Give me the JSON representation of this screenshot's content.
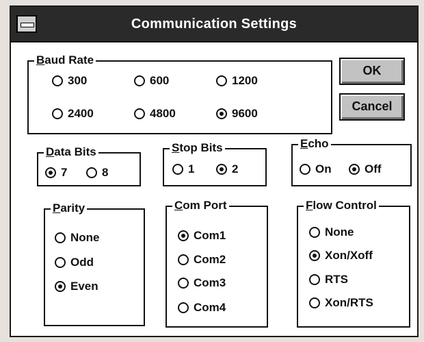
{
  "title": "Communication Settings",
  "baud_rate": {
    "legend_key": "B",
    "legend_rest": "aud Rate",
    "options": [
      {
        "label": "300",
        "selected": false
      },
      {
        "label": "600",
        "selected": false
      },
      {
        "label": "1200",
        "selected": false
      },
      {
        "label": "2400",
        "selected": false
      },
      {
        "label": "4800",
        "selected": false
      },
      {
        "label": "9600",
        "selected": true
      }
    ]
  },
  "data_bits": {
    "legend_key": "D",
    "legend_rest": "ata Bits",
    "options": [
      {
        "label": "7",
        "selected": true
      },
      {
        "label": "8",
        "selected": false
      }
    ]
  },
  "stop_bits": {
    "legend_key": "S",
    "legend_rest": "top Bits",
    "options": [
      {
        "label": "1",
        "selected": false
      },
      {
        "label": "2",
        "selected": true
      }
    ]
  },
  "echo": {
    "legend_key": "E",
    "legend_rest": "cho",
    "options": [
      {
        "label": "On",
        "selected": false
      },
      {
        "label": "Off",
        "selected": true
      }
    ]
  },
  "parity": {
    "legend_key": "P",
    "legend_rest": "arity",
    "options": [
      {
        "label": "None",
        "selected": false
      },
      {
        "label": "Odd",
        "selected": false
      },
      {
        "label": "Even",
        "selected": true
      }
    ]
  },
  "com_port": {
    "legend_key": "C",
    "legend_rest": "om Port",
    "options": [
      {
        "label": "Com1",
        "selected": true
      },
      {
        "label": "Com2",
        "selected": false
      },
      {
        "label": "Com3",
        "selected": false
      },
      {
        "label": "Com4",
        "selected": false
      }
    ]
  },
  "flow_control": {
    "legend_key": "F",
    "legend_rest": "low Control",
    "options": [
      {
        "label": "None",
        "selected": false
      },
      {
        "label": "Xon/Xoff",
        "selected": true
      },
      {
        "label": "RTS",
        "selected": false
      },
      {
        "label": "Xon/RTS",
        "selected": false
      }
    ]
  },
  "buttons": {
    "ok": "OK",
    "cancel": "Cancel"
  },
  "icons": {
    "system_menu": "system-menu-icon",
    "radio": "radio-button-icon"
  }
}
